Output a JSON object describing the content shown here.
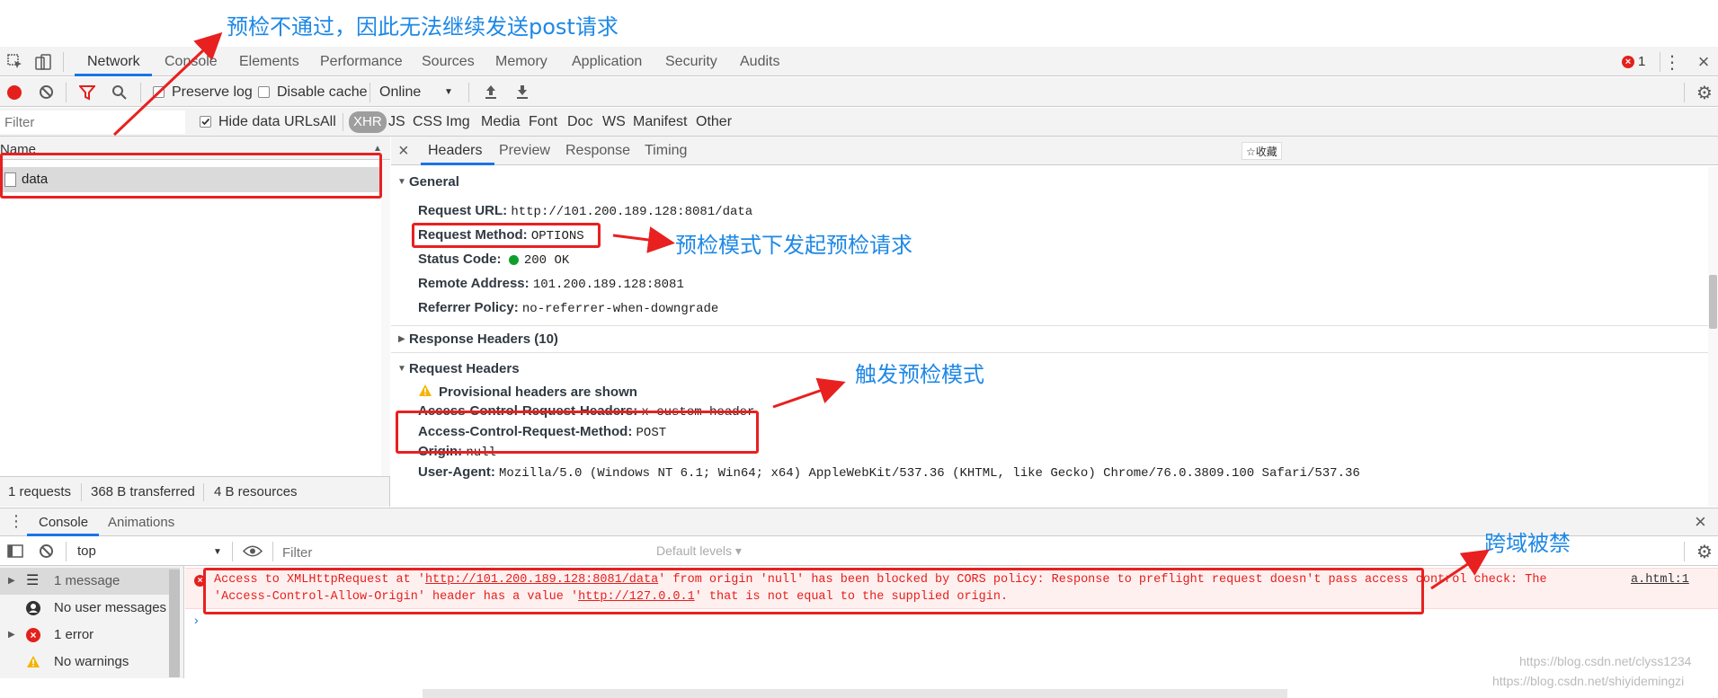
{
  "annotations": {
    "top": "预检不通过，因此无法继续发送post请求",
    "method": "预检模式下发起预检请求",
    "trigger": "触发预检模式",
    "cors": "跨域被禁"
  },
  "devtools": {
    "tabs": [
      "Network",
      "Console",
      "Elements",
      "Performance",
      "Sources",
      "Memory",
      "Application",
      "Security",
      "Audits"
    ],
    "error_count": "1"
  },
  "network_toolbar": {
    "preserve_log": "Preserve log",
    "disable_cache": "Disable cache",
    "throttle": "Online"
  },
  "filter_bar": {
    "placeholder": "Filter",
    "hide_data_urls": "Hide data URLs",
    "types": [
      "All",
      "XHR",
      "JS",
      "CSS",
      "Img",
      "Media",
      "Font",
      "Doc",
      "WS",
      "Manifest",
      "Other"
    ]
  },
  "request_list": {
    "column_name": "Name",
    "rows": [
      "data"
    ],
    "status": {
      "requests": "1 requests",
      "transferred": "368 B transferred",
      "resources": "4 B resources"
    }
  },
  "details": {
    "tabs": [
      "Headers",
      "Preview",
      "Response",
      "Timing"
    ],
    "bookmark_tip": "☆收藏",
    "general": {
      "title": "General",
      "request_url_k": "Request URL:",
      "request_url_v": "http://101.200.189.128:8081/data",
      "method_k": "Request Method:",
      "method_v": "OPTIONS",
      "status_k": "Status Code:",
      "status_v": "200 OK",
      "remote_k": "Remote Address:",
      "remote_v": "101.200.189.128:8081",
      "referrer_k": "Referrer Policy:",
      "referrer_v": "no-referrer-when-downgrade"
    },
    "response_headers": "Response Headers (10)",
    "request_headers": {
      "title": "Request Headers",
      "warning": "Provisional headers are shown",
      "acrh_k": "Access-Control-Request-Headers:",
      "acrh_v": "x-custom-header",
      "acrm_k": "Access-Control-Request-Method:",
      "acrm_v": "POST",
      "origin_k": "Origin:",
      "origin_v": "null",
      "ua_k": "User-Agent:",
      "ua_v": "Mozilla/5.0 (Windows NT 6.1; Win64; x64) AppleWebKit/537.36 (KHTML, like Gecko) Chrome/76.0.3809.100 Safari/537.36"
    }
  },
  "drawer": {
    "tabs": [
      "Console",
      "Animations"
    ],
    "context": "top",
    "filter_placeholder": "Filter",
    "levels": "Default levels ▾",
    "sidebar": [
      "1 message",
      "No user messages",
      "1 error",
      "No warnings"
    ],
    "error": {
      "line1_a": "Access to XMLHttpRequest at '",
      "line1_link": "http://101.200.189.128:8081/data",
      "line1_b": "' from origin 'null' has been blocked by CORS policy: Response to preflight request doesn't pass access control check: The",
      "line2_a": "'Access-Control-Allow-Origin' header has a value '",
      "line2_link": "http://127.0.0.1",
      "line2_b": "' that is not equal to the supplied origin.",
      "source": "a.html:1"
    }
  },
  "watermark": {
    "line1": "https://blog.csdn.net/clyss1234",
    "line2": "https://blog.csdn.net/shiyidemingzi"
  },
  "colors": {
    "annotation_red": "#e82020",
    "annotation_blue": "#1e88e5",
    "accent": "#1a73e8",
    "error_red": "#e4201c"
  }
}
